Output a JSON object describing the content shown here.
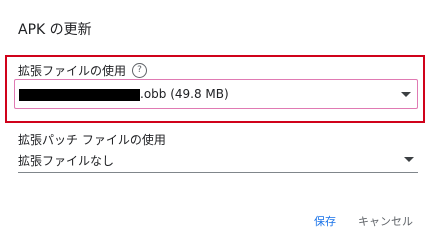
{
  "dialog": {
    "title": "APK の更新",
    "expansion_file": {
      "label": "拡張ファイルの使用",
      "help_icon": "help-circle-icon",
      "value": ".obb (49.8 MB)",
      "dropdown_icon": "arrow-drop-down-icon"
    },
    "patch_file": {
      "label": "拡張パッチ ファイルの使用",
      "value": "拡張ファイルなし",
      "dropdown_icon": "arrow-drop-down-icon"
    },
    "actions": {
      "save": "保存",
      "cancel": "キャンセル"
    }
  },
  "colors": {
    "highlight_border": "#d0021b",
    "primary": "#1a73e8",
    "focus_border": "#e07ab3"
  }
}
